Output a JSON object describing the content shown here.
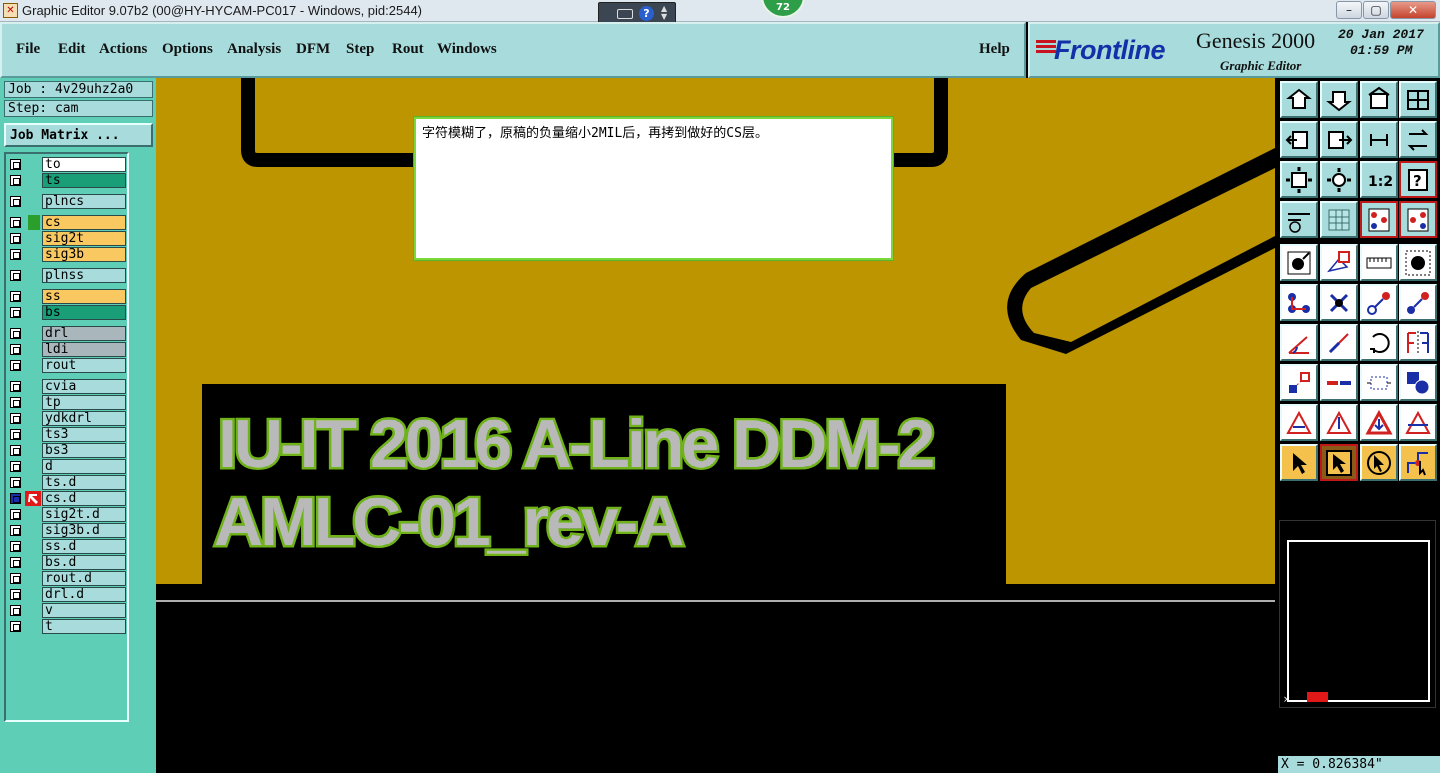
{
  "window": {
    "title": "Graphic Editor 9.07b2 (00@HY-HYCAM-PC017 - Windows, pid:2544)",
    "badge": "72",
    "help_glyph": "?",
    "minimize_glyph": "–",
    "maximize_glyph": "▢",
    "close_glyph": "✕"
  },
  "menu": {
    "items": [
      "File",
      "Edit",
      "Actions",
      "Options",
      "Analysis",
      "DFM",
      "Step",
      "Rout",
      "Windows"
    ],
    "help": "Help"
  },
  "brand": {
    "logo": "Frontline",
    "product": "Genesis 2000",
    "subtitle": "Graphic Editor",
    "date": "20 Jan 2017",
    "time": "01:59 PM"
  },
  "job": {
    "job_label": "Job : 4v29uhz2a0",
    "step_label": "Step: cam",
    "matrix_button": "Job Matrix ..."
  },
  "colors": {
    "copper": "#bd9500",
    "text_green": "#6fb21a",
    "text_outline": "#5a7a0a",
    "layer_white": "#ffffff",
    "layer_teal": "#1a9e78",
    "layer_orange": "#f9c860",
    "layer_grey": "#a9b6bc",
    "layer_panel": "#a8dcdc"
  },
  "layers": [
    {
      "name": "to",
      "color": "white",
      "indicator": ""
    },
    {
      "name": "ts",
      "color": "teal",
      "indicator": ""
    },
    {
      "name": "plncs",
      "color": "panel",
      "indicator": "",
      "gap": true
    },
    {
      "name": "cs",
      "color": "orange",
      "indicator": "green",
      "gap": true
    },
    {
      "name": "sig2t",
      "color": "orange",
      "indicator": ""
    },
    {
      "name": "sig3b",
      "color": "orange",
      "indicator": ""
    },
    {
      "name": "plnss",
      "color": "panel",
      "indicator": "",
      "gap": true
    },
    {
      "name": "ss",
      "color": "orange",
      "indicator": "",
      "gap": true
    },
    {
      "name": "bs",
      "color": "teal",
      "indicator": ""
    },
    {
      "name": "drl",
      "color": "grey",
      "indicator": "",
      "gap": true
    },
    {
      "name": "ldi",
      "color": "grey",
      "indicator": ""
    },
    {
      "name": "rout",
      "color": "panel",
      "indicator": ""
    },
    {
      "name": "cvia",
      "color": "panel",
      "indicator": "",
      "gap": true
    },
    {
      "name": "tp",
      "color": "panel",
      "indicator": ""
    },
    {
      "name": "ydkdrl",
      "color": "panel",
      "indicator": ""
    },
    {
      "name": "ts3",
      "color": "panel",
      "indicator": ""
    },
    {
      "name": "bs3",
      "color": "panel",
      "indicator": ""
    },
    {
      "name": "d",
      "color": "panel",
      "indicator": ""
    },
    {
      "name": "ts.d",
      "color": "panel",
      "indicator": ""
    },
    {
      "name": "cs.d",
      "color": "panel",
      "indicator": "cursor",
      "active": true
    },
    {
      "name": "sig2t.d",
      "color": "panel",
      "indicator": ""
    },
    {
      "name": "sig3b.d",
      "color": "panel",
      "indicator": ""
    },
    {
      "name": "ss.d",
      "color": "panel",
      "indicator": ""
    },
    {
      "name": "bs.d",
      "color": "panel",
      "indicator": ""
    },
    {
      "name": "rout.d",
      "color": "panel",
      "indicator": ""
    },
    {
      "name": "drl.d",
      "color": "panel",
      "indicator": ""
    },
    {
      "name": "v",
      "color": "panel",
      "indicator": ""
    },
    {
      "name": "t",
      "color": "panel",
      "indicator": ""
    }
  ],
  "note": {
    "text": "字符模糊了，原稿的负量缩小2MIL后，再拷到做好的CS层。"
  },
  "board_text": {
    "line1": "IU-IT 2016 A-Line DDM-2",
    "line2": "AMLC-01_rev-A"
  },
  "toolbar_top": [
    {
      "icon": "zoom-home-icon",
      "style": ""
    },
    {
      "icon": "zoom-back-icon",
      "style": ""
    },
    {
      "icon": "home-screen-icon",
      "style": ""
    },
    {
      "icon": "window-split-icon",
      "style": ""
    },
    {
      "icon": "pan-left-icon",
      "style": ""
    },
    {
      "icon": "pan-right-icon",
      "style": ""
    },
    {
      "icon": "swap-icon",
      "style": ""
    },
    {
      "icon": "redraw-icon",
      "style": ""
    },
    {
      "icon": "fit-screen-icon",
      "style": ""
    },
    {
      "icon": "zoom-center-icon",
      "style": ""
    },
    {
      "icon": "scale-1-2-icon",
      "style": "",
      "label": "1:2"
    },
    {
      "icon": "help-query-icon",
      "style": "red",
      "label": "?"
    },
    {
      "icon": "measure-tool-icon",
      "style": ""
    },
    {
      "icon": "grid-icon",
      "style": ""
    },
    {
      "icon": "layer-stack-icon",
      "style": "red"
    },
    {
      "icon": "layer-stack-2-icon",
      "style": "red"
    }
  ],
  "toolbar_bottom": [
    {
      "icon": "add-pad-icon",
      "style": ""
    },
    {
      "icon": "add-shape-icon",
      "style": ""
    },
    {
      "icon": "ruler-icon",
      "style": ""
    },
    {
      "icon": "circle-pad-icon",
      "style": ""
    },
    {
      "icon": "connect-nodes-icon",
      "style": ""
    },
    {
      "icon": "delete-node-icon",
      "style": ""
    },
    {
      "icon": "move-node-icon",
      "style": ""
    },
    {
      "icon": "copy-node-icon",
      "style": ""
    },
    {
      "icon": "angle-line-icon",
      "style": ""
    },
    {
      "icon": "draw-line-icon",
      "style": ""
    },
    {
      "icon": "rotate-icon",
      "style": ""
    },
    {
      "icon": "mirror-icon",
      "style": ""
    },
    {
      "icon": "snap-point-icon",
      "style": ""
    },
    {
      "icon": "split-line-icon",
      "style": ""
    },
    {
      "icon": "resize-box-icon",
      "style": ""
    },
    {
      "icon": "pads-group-icon",
      "style": ""
    },
    {
      "icon": "triangle-a-icon",
      "style": ""
    },
    {
      "icon": "triangle-b-icon",
      "style": ""
    },
    {
      "icon": "triangle-c-icon",
      "style": ""
    },
    {
      "icon": "triangle-d-icon",
      "style": ""
    },
    {
      "icon": "select-arrow-icon",
      "style": "or"
    },
    {
      "icon": "select-arrow-active-icon",
      "style": "sel"
    },
    {
      "icon": "select-area-icon",
      "style": "or"
    },
    {
      "icon": "select-net-icon",
      "style": "or"
    }
  ],
  "status": {
    "coordinate": "X = 0.826384\""
  }
}
